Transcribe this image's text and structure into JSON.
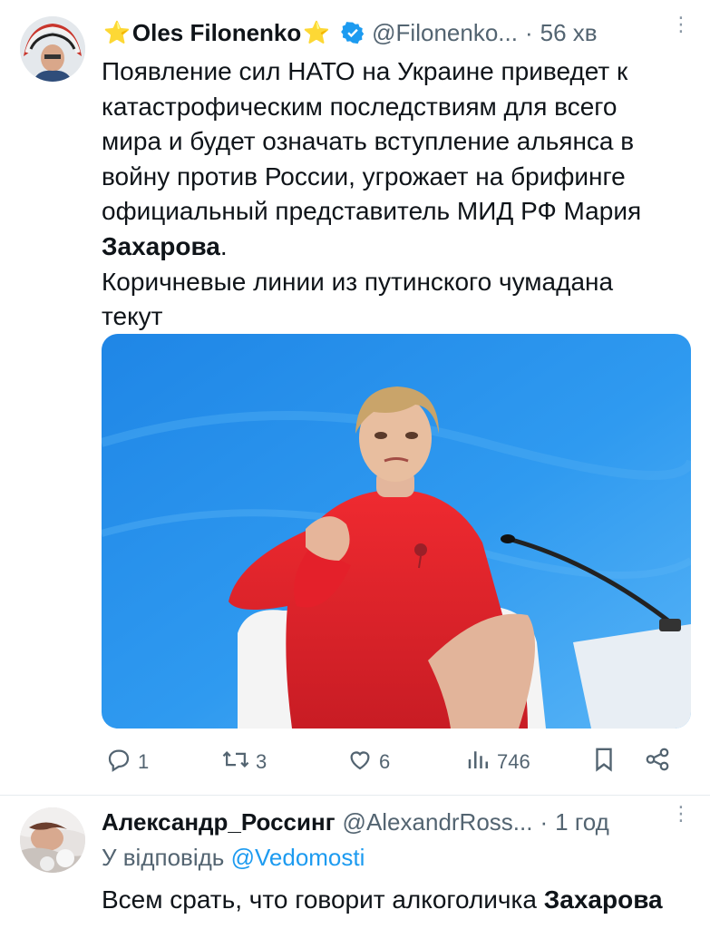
{
  "tweet": {
    "author_name": "Oles Filonenko",
    "star_icon": "⭐",
    "handle": "@Filonenko...",
    "separator": "·",
    "time": "56 хв",
    "more_glyph": "⋮",
    "text_lines": [
      "Появление сил НАТО на Украине приведет к",
      "катастрофическим последствиям для всего",
      "мира и будет означать вступление альянса в",
      "войну против России, угрожает на брифинге",
      "официальный представитель МИД РФ Мария"
    ],
    "text_bold": "Захарова",
    "text_bold_suffix": ".",
    "text_line2": "Коричневые линии из путинского чумадана",
    "text_line3": "текут",
    "actions": {
      "replies": "1",
      "retweets": "3",
      "likes": "6",
      "views": "746"
    }
  },
  "reply": {
    "author_name": "Александр_Россинг",
    "handle": "@AlexandrRoss...",
    "separator": "·",
    "time": "1 год",
    "more_glyph": "⋮",
    "reply_prefix": "У відповідь",
    "reply_to": "@Vedomosti",
    "text_plain": "Всем срать, что говорит алкоголичка ",
    "text_bold": "Захарова"
  },
  "colors": {
    "accent": "#1d9bf0",
    "secondary_text": "#536471",
    "photo_background": "#2a8ee8",
    "dress": "#e8202a"
  },
  "icons": [
    "reply-icon",
    "retweet-icon",
    "like-icon",
    "views-icon",
    "bookmark-icon",
    "share-icon",
    "verified-badge-icon",
    "more-icon"
  ]
}
